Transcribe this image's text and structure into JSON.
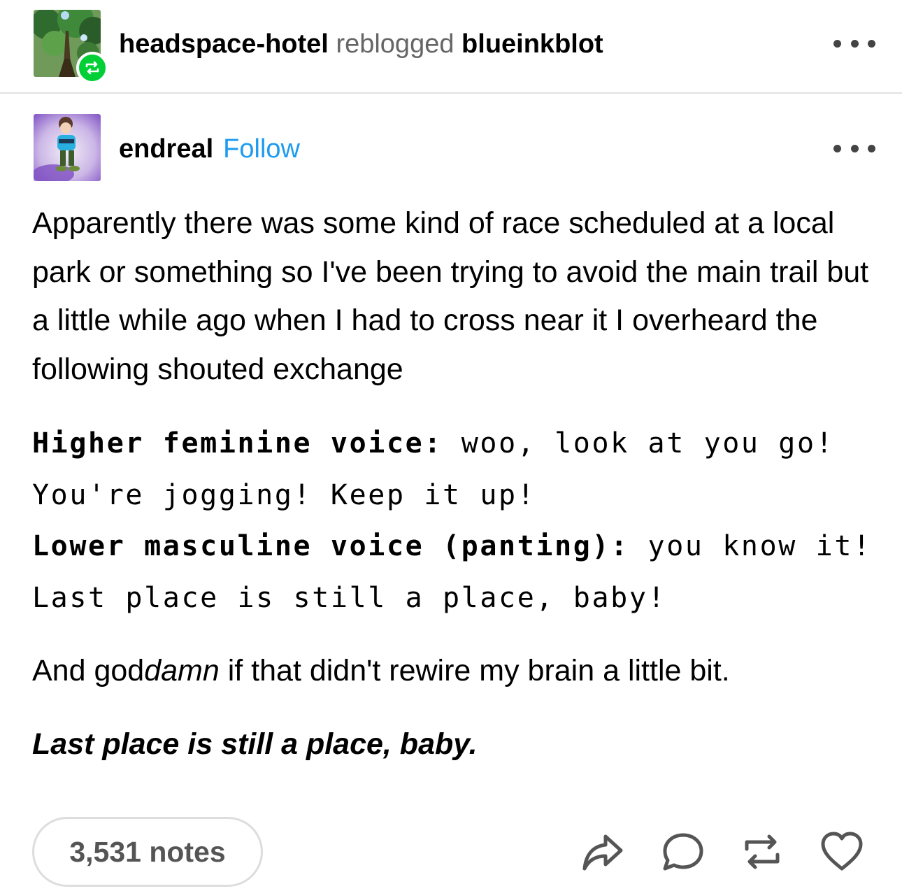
{
  "header": {
    "reblogger": "headspace-hotel",
    "action_text": "reblogged",
    "source": "blueinkblot"
  },
  "post": {
    "author": "endreal",
    "follow_label": "Follow",
    "paragraph_1": "Apparently there was some kind of race scheduled at a local park or something so I've been trying to avoid the main trail but a little while ago when I had to cross near it I overheard the following shouted exchange",
    "dialogue": [
      {
        "speaker": "Higher feminine voice:",
        "line": "woo, look at you go! You're jogging! Keep it up!"
      },
      {
        "speaker": "Lower masculine voice (panting):",
        "line": "you know it! Last place is still a place, baby!"
      }
    ],
    "closing": {
      "prefix": "And god",
      "emphasis": "damn",
      "suffix": " if that didn't rewire my brain a little bit."
    },
    "final_line": "Last place is still a place, baby.",
    "notes": "3,531 notes"
  },
  "icons": [
    "reblog-badge-icon",
    "more-options-icon",
    "share-icon",
    "reply-icon",
    "reblog-icon",
    "like-icon"
  ],
  "colors": {
    "reblog_green": "#00cf35",
    "follow_blue": "#1d9bf0",
    "muted_gray": "#666666"
  }
}
